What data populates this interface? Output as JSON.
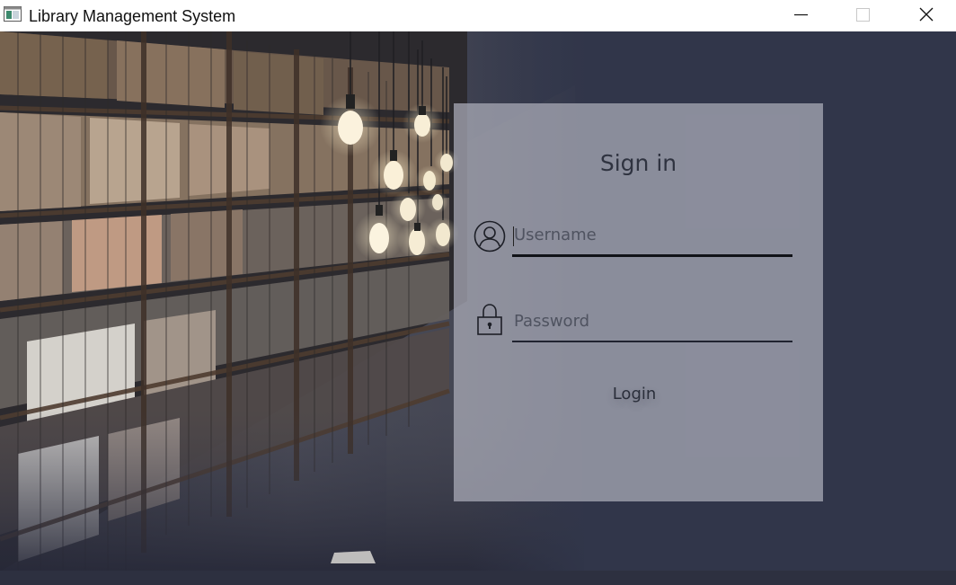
{
  "window": {
    "title": "Library Management System",
    "icons": {
      "app": "app-window-icon",
      "minimize": "minimize-icon",
      "maximize": "maximize-icon",
      "close": "close-icon"
    }
  },
  "login": {
    "heading": "Sign in",
    "username": {
      "icon": "user-circle-icon",
      "placeholder": "Username",
      "value": ""
    },
    "password": {
      "icon": "lock-icon",
      "placeholder": "Password",
      "value": ""
    },
    "submit_label": "Login"
  },
  "colors": {
    "background": "#31364a",
    "panel": "#aaacb8",
    "text": "#2f3340"
  }
}
